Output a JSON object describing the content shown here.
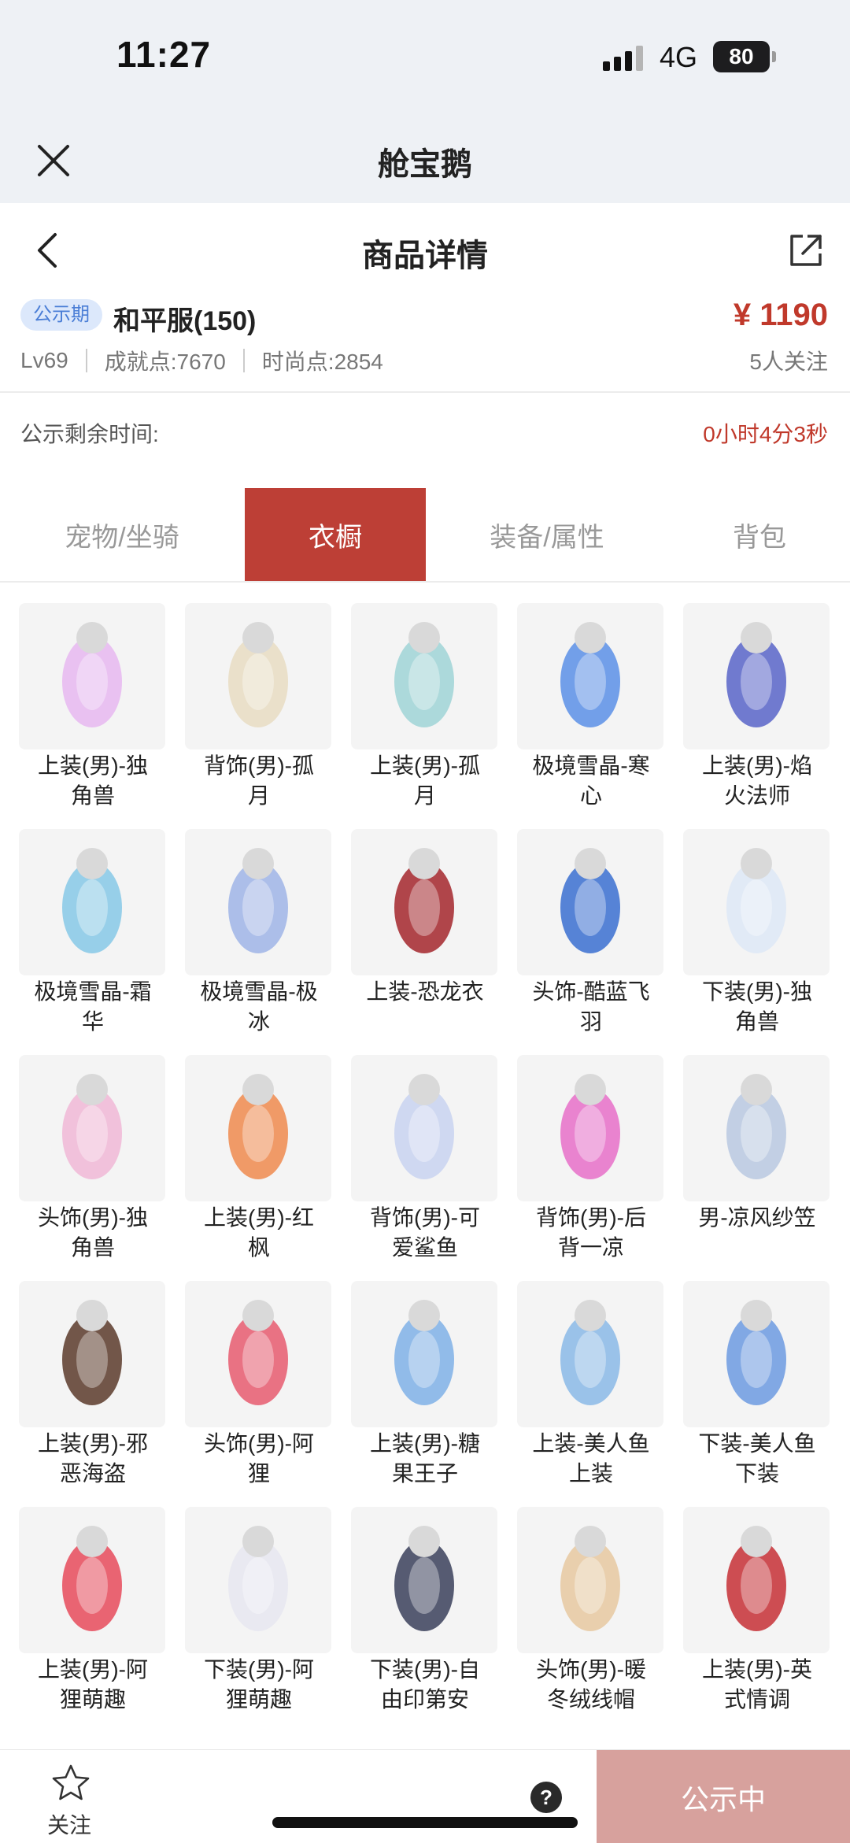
{
  "status": {
    "time": "11:27",
    "network": "4G",
    "battery": "80"
  },
  "app": {
    "title": "舱宝鹅"
  },
  "nav": {
    "title": "商品详情"
  },
  "product": {
    "badge": "公示期",
    "server": "和平服(150)",
    "price": "¥ 1190",
    "level": "Lv69",
    "achievement": "成就点:7670",
    "fashion": "时尚点:2854",
    "followers": "5人关注"
  },
  "timer": {
    "label": "公示剩余时间:",
    "value": "0小时4分3秒"
  },
  "tabs": [
    {
      "label": "宠物/坐骑",
      "active": false
    },
    {
      "label": "衣橱",
      "active": true
    },
    {
      "label": "装备/属性",
      "active": false
    },
    {
      "label": "背包",
      "active": false
    }
  ],
  "items": [
    {
      "line1": "上装(男)-独",
      "line2": "角兽",
      "icon": "unicorn-outfit-icon",
      "color": "#e6b7f0"
    },
    {
      "line1": "背饰(男)-孤",
      "line2": "月",
      "icon": "ribbon-back-icon",
      "color": "#e7dcc2"
    },
    {
      "line1": "上装(男)-孤",
      "line2": "月",
      "icon": "robe-outfit-icon",
      "color": "#9fd3d6"
    },
    {
      "line1": "极境雪晶-寒",
      "line2": "心",
      "icon": "ice-sword-icon",
      "color": "#5a8fe6"
    },
    {
      "line1": "上装(男)-焰",
      "line2": "火法师",
      "icon": "mage-outfit-icon",
      "color": "#5864c8"
    },
    {
      "line1": "极境雪晶-霜",
      "line2": "华",
      "icon": "ice-crossbow-icon",
      "color": "#86c8e6"
    },
    {
      "line1": "极境雪晶-极",
      "line2": "冰",
      "icon": "ice-bow-icon",
      "color": "#9fb4e6"
    },
    {
      "line1": "上装-恐龙衣",
      "line2": "",
      "icon": "dino-costume-icon",
      "color": "#a3262b"
    },
    {
      "line1": "头饰-酷蓝飞",
      "line2": "羽",
      "icon": "blue-cap-icon",
      "color": "#3a6fd0"
    },
    {
      "line1": "下装(男)-独",
      "line2": "角兽",
      "icon": "white-shorts-icon",
      "color": "#dde7f6"
    },
    {
      "line1": "头饰(男)-独",
      "line2": "角兽",
      "icon": "unicorn-hood-icon",
      "color": "#f0b7d6"
    },
    {
      "line1": "上装(男)-红",
      "line2": "枫",
      "icon": "maple-robe-icon",
      "color": "#ef8a4e"
    },
    {
      "line1": "背饰(男)-可",
      "line2": "爱鲨鱼",
      "icon": "shark-backpack-icon",
      "color": "#c8d2f0"
    },
    {
      "line1": "背饰(男)-后",
      "line2": "背一凉",
      "icon": "icecream-back-icon",
      "color": "#e66fc8"
    },
    {
      "line1": "男-凉风纱笠",
      "line2": "",
      "icon": "veil-hat-icon",
      "color": "#b8c8e0"
    },
    {
      "line1": "上装(男)-邪",
      "line2": "恶海盗",
      "icon": "pirate-coat-icon",
      "color": "#5a3a2a"
    },
    {
      "line1": "头饰(男)-阿",
      "line2": "狸",
      "icon": "fox-head-icon",
      "color": "#e65a6e"
    },
    {
      "line1": "上装(男)-糖",
      "line2": "果王子",
      "icon": "prince-coat-icon",
      "color": "#7fb0e6"
    },
    {
      "line1": "上装-美人鱼",
      "line2": "上装",
      "icon": "mermaid-top-icon",
      "color": "#8ab8e6"
    },
    {
      "line1": "下装-美人鱼",
      "line2": "下装",
      "icon": "mermaid-skirt-icon",
      "color": "#6c9ae0"
    },
    {
      "line1": "上装(男)-阿",
      "line2": "狸萌趣",
      "icon": "fox-hoodie-icon",
      "color": "#e64a5a"
    },
    {
      "line1": "下装(男)-阿",
      "line2": "狸萌趣",
      "icon": "white-pants-icon",
      "color": "#e6e6f0"
    },
    {
      "line1": "下装(男)-自",
      "line2": "由印第安",
      "icon": "tribal-legs-icon",
      "color": "#3a3f5a"
    },
    {
      "line1": "头饰(男)-暖",
      "line2": "冬绒线帽",
      "icon": "knit-hat-icon",
      "color": "#e6c8a0"
    },
    {
      "line1": "上装(男)-英",
      "line2": "式情调",
      "icon": "red-vest-icon",
      "color": "#c62f35"
    }
  ],
  "bottom": {
    "follow_label": "关注",
    "help": "?",
    "cta": "公示中"
  }
}
